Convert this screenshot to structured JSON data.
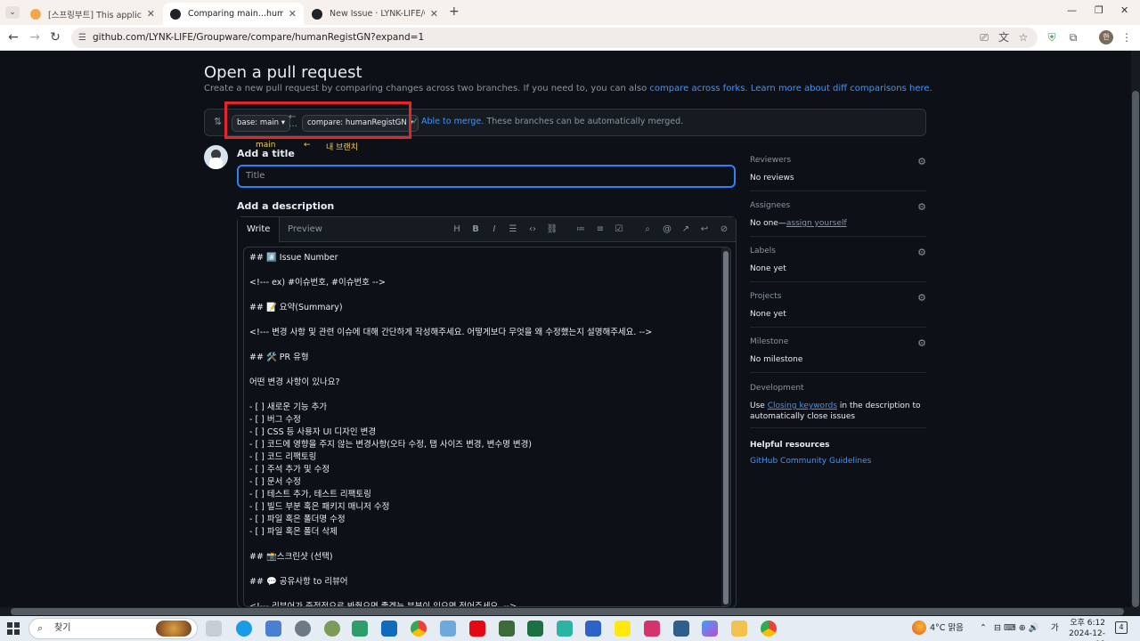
{
  "browser": {
    "tabs": [
      {
        "title": "[스프링부트] This application ha",
        "active": false,
        "favicon_color": "#f3a64b"
      },
      {
        "title": "Comparing main...humanRegistG",
        "active": true,
        "favicon_color": "#1f2328"
      },
      {
        "title": "New Issue · LYNK-LIFE/Groupw",
        "active": false,
        "favicon_color": "#1f2328"
      }
    ],
    "url": "github.com/LYNK-LIFE/Groupware/compare/humanRegistGN?expand=1",
    "profile_initial": "한"
  },
  "page": {
    "title": "Open a pull request",
    "subtitle_text": "Create a new pull request by comparing changes across two branches. If you need to, you can also",
    "compare_forks_link": "compare across forks.",
    "learn_more_link": "Learn more about diff comparisons here.",
    "base_branch": "base: main",
    "compare_branch": "compare: humanRegistGN",
    "merge_status": "Able to merge.",
    "merge_status_detail": "These branches can be automatically merged.",
    "annotation_main": "main",
    "annotation_arrow": "←",
    "annotation_mine": "내 브랜치",
    "add_title_label": "Add a title",
    "title_placeholder": "Title",
    "add_description_label": "Add a description",
    "editor_tabs": [
      "Write",
      "Preview"
    ],
    "description_lines": [
      "## #️⃣ Issue Number",
      "",
      "<!--- ex) #이슈번호, #이슈번호 -->",
      "",
      "## 📝 요약(Summary)",
      "",
      "<!--- 변경 사항 및 관련 이슈에 대해 간단하게 작성해주세요. 어떻게보다 무엇을 왜 수정했는지 설명해주세요. -->",
      "",
      "## 🛠️ PR 유형",
      "",
      "어떤 변경 사항이 있나요?",
      "",
      "- [ ] 새로운 기능 추가",
      "- [ ] 버그 수정",
      "- [ ] CSS 등 사용자 UI 디자인 변경",
      "- [ ] 코드에 영향을 주지 않는 변경사항(오타 수정, 탭 사이즈 변경, 변수명 변경)",
      "- [ ] 코드 리팩토링",
      "- [ ] 주석 추가 및 수정",
      "- [ ] 문서 수정",
      "- [ ] 테스트 추가, 테스트 리팩토링",
      "- [ ] 빌드 부분 혹은 패키지 매니저 수정",
      "- [ ] 파일 혹은 폴더명 수정",
      "- [ ] 파일 혹은 폴더 삭제",
      "",
      "## 📸스크린샷 (선택)",
      "",
      "## 💬 공유사항 to 리뷰어",
      "",
      "<!--- 리뷰어가 중점적으로 봐줬으면 좋겠는 부분이 있으면 적어주세요. -->"
    ]
  },
  "sidebar": {
    "reviewers": {
      "label": "Reviewers",
      "value": "No reviews"
    },
    "assignees": {
      "label": "Assignees",
      "value": "No one—",
      "link": "assign yourself"
    },
    "labels": {
      "label": "Labels",
      "value": "None yet"
    },
    "projects": {
      "label": "Projects",
      "value": "None yet"
    },
    "milestone": {
      "label": "Milestone",
      "value": "No milestone"
    },
    "development": {
      "label": "Development",
      "prefix": "Use ",
      "link": "Closing keywords",
      "suffix": " in the description to automatically close issues"
    },
    "helpful": {
      "label": "Helpful resources",
      "link": "GitHub Community Guidelines"
    }
  },
  "taskbar": {
    "search_label": "찾기",
    "weather": "4°C 맑음",
    "ime": "가",
    "time": "오후 6:12",
    "date": "2024-12-08"
  }
}
